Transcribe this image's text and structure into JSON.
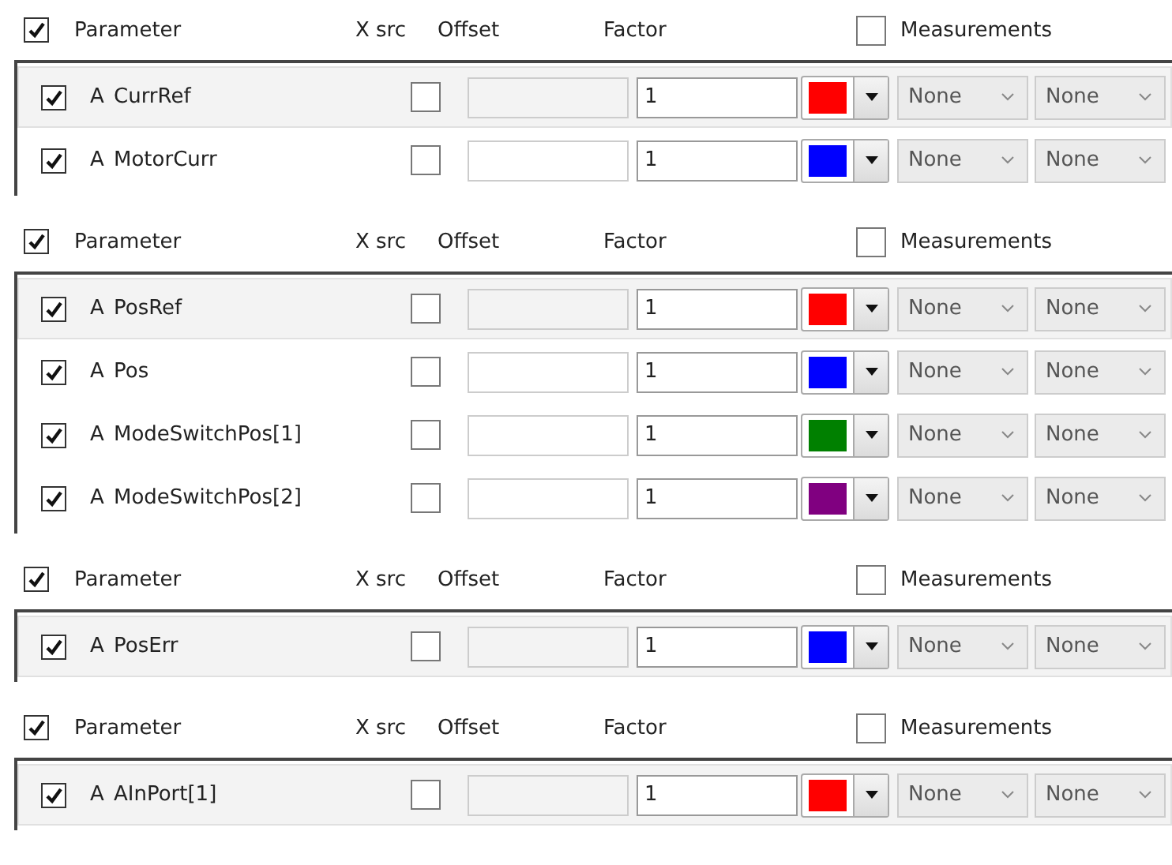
{
  "panels": [
    {
      "header": {
        "checked": true,
        "parameter": "Parameter",
        "xsrc": "X src",
        "offset": "Offset",
        "factor": "Factor",
        "measurements_checked": false,
        "measurements": "Measurements"
      },
      "rows": [
        {
          "selected": true,
          "checked": true,
          "type": "A",
          "name": "CurrRef",
          "xsrc": false,
          "factor": "1",
          "color": "#ff0000",
          "measure_1": "None",
          "measure_2": "None"
        },
        {
          "selected": false,
          "checked": true,
          "type": "A",
          "name": "MotorCurr",
          "xsrc": false,
          "factor": "1",
          "color": "#0000ff",
          "measure_1": "None",
          "measure_2": "None"
        }
      ]
    },
    {
      "header": {
        "checked": true,
        "parameter": "Parameter",
        "xsrc": "X src",
        "offset": "Offset",
        "factor": "Factor",
        "measurements_checked": false,
        "measurements": "Measurements"
      },
      "rows": [
        {
          "selected": true,
          "checked": true,
          "type": "A",
          "name": "PosRef",
          "xsrc": false,
          "factor": "1",
          "color": "#ff0000",
          "measure_1": "None",
          "measure_2": "None"
        },
        {
          "selected": false,
          "checked": true,
          "type": "A",
          "name": "Pos",
          "xsrc": false,
          "factor": "1",
          "color": "#0000ff",
          "measure_1": "None",
          "measure_2": "None"
        },
        {
          "selected": false,
          "checked": true,
          "type": "A",
          "name": "ModeSwitchPos[1]",
          "xsrc": false,
          "factor": "1",
          "color": "#008000",
          "measure_1": "None",
          "measure_2": "None"
        },
        {
          "selected": false,
          "checked": true,
          "type": "A",
          "name": "ModeSwitchPos[2]",
          "xsrc": false,
          "factor": "1",
          "color": "#800080",
          "measure_1": "None",
          "measure_2": "None"
        }
      ]
    },
    {
      "header": {
        "checked": true,
        "parameter": "Parameter",
        "xsrc": "X src",
        "offset": "Offset",
        "factor": "Factor",
        "measurements_checked": false,
        "measurements": "Measurements"
      },
      "rows": [
        {
          "selected": true,
          "checked": true,
          "type": "A",
          "name": "PosErr",
          "xsrc": false,
          "factor": "1",
          "color": "#0000ff",
          "measure_1": "None",
          "measure_2": "None"
        }
      ]
    },
    {
      "header": {
        "checked": true,
        "parameter": "Parameter",
        "xsrc": "X src",
        "offset": "Offset",
        "factor": "Factor",
        "measurements_checked": false,
        "measurements": "Measurements"
      },
      "rows": [
        {
          "selected": true,
          "checked": true,
          "type": "A",
          "name": "AInPort[1]",
          "xsrc": false,
          "factor": "1",
          "color": "#ff0000",
          "measure_1": "None",
          "measure_2": "None"
        }
      ]
    }
  ]
}
